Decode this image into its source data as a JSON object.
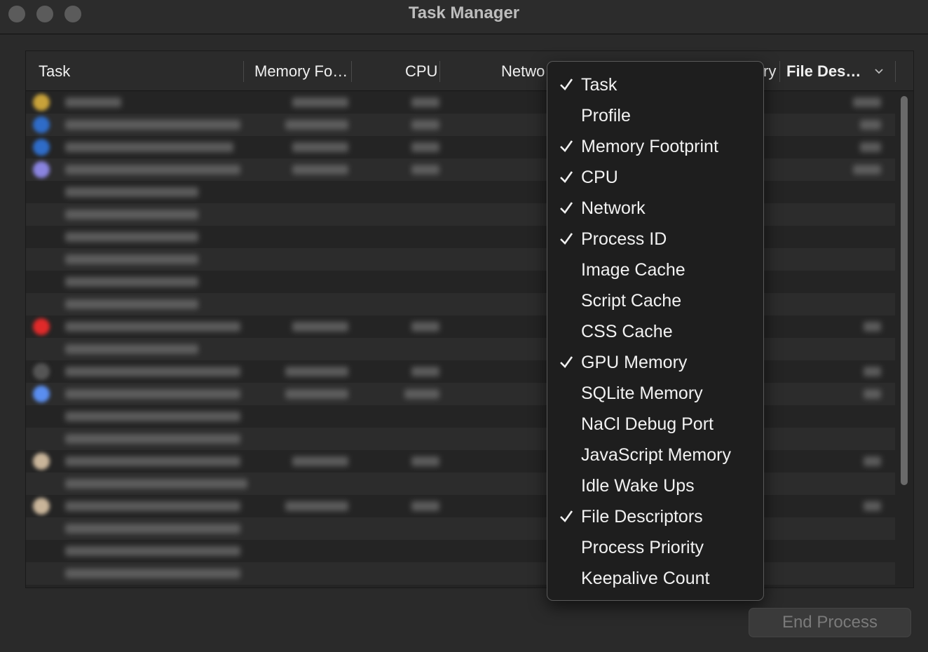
{
  "window": {
    "title": "Task Manager"
  },
  "table": {
    "columns": [
      "Task",
      "Memory Fo…",
      "CPU",
      "Netwo",
      "ry",
      "File Des…"
    ]
  },
  "menu": {
    "items": [
      {
        "label": "Task",
        "checked": true
      },
      {
        "label": "Profile",
        "checked": false
      },
      {
        "label": "Memory Footprint",
        "checked": true
      },
      {
        "label": "CPU",
        "checked": true
      },
      {
        "label": "Network",
        "checked": true
      },
      {
        "label": "Process ID",
        "checked": true
      },
      {
        "label": "Image Cache",
        "checked": false
      },
      {
        "label": "Script Cache",
        "checked": false
      },
      {
        "label": "CSS Cache",
        "checked": false
      },
      {
        "label": "GPU Memory",
        "checked": true
      },
      {
        "label": "SQLite Memory",
        "checked": false
      },
      {
        "label": "NaCl Debug Port",
        "checked": false
      },
      {
        "label": "JavaScript Memory",
        "checked": false
      },
      {
        "label": "Idle Wake Ups",
        "checked": false
      },
      {
        "label": "File Descriptors",
        "checked": true
      },
      {
        "label": "Process Priority",
        "checked": false
      },
      {
        "label": "Keepalive Count",
        "checked": false
      }
    ]
  },
  "footer": {
    "end_process_label": "End Process"
  },
  "colors": {
    "background": "#2a2a2a",
    "menu": "#1e1e1e",
    "text": "#e6e6e6"
  }
}
